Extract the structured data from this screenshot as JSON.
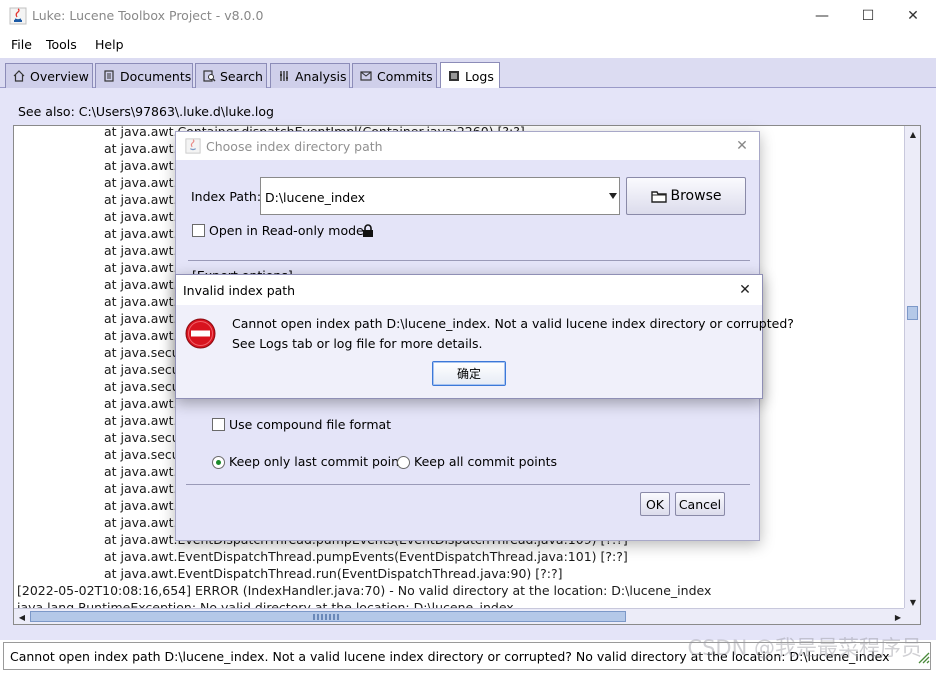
{
  "window": {
    "title": "Luke: Lucene Toolbox Project - v8.0.0",
    "minimize_glyph": "—",
    "maximize_glyph": "☐",
    "close_glyph": "✕"
  },
  "menu": {
    "file": "File",
    "tools": "Tools",
    "help": "Help"
  },
  "tabs": [
    {
      "label": "Overview",
      "icon": "home-icon"
    },
    {
      "label": "Documents",
      "icon": "documents-icon"
    },
    {
      "label": "Search",
      "icon": "search-icon"
    },
    {
      "label": "Analysis",
      "icon": "analysis-icon"
    },
    {
      "label": "Commits",
      "icon": "commits-icon"
    },
    {
      "label": "Logs",
      "icon": "logs-icon",
      "active": true
    }
  ],
  "logs": {
    "see_also": "See also: C:\\Users\\97863\\.luke.d\\luke.log",
    "lines": [
      "at java.awt.Container.dispatchEventImpl(Container.java:2260) [?:?]",
      "at java.awt.C",
      "at java.awt.C",
      "at java.awt.C",
      "at java.awt.Li",
      "at java.awt.Li",
      "at java.awt.Li",
      "at java.awt.C",
      "at java.awt.W",
      "at java.awt.C",
      "at java.awt.E",
      "at java.awt.E",
      "at java.awt.E",
      "at java.secu",
      "at java.secu",
      "at java.secu",
      "at java.awt.E",
      "at java.awt.E",
      "at java.secu",
      "at java.secu",
      "at java.awt.E",
      "at java.awt.E",
      "at java.awt.E",
      "at java.awt.E",
      "at java.awt.EventDispatchThread.pumpEvents(EventDispatchThread.java:109) [?:?]",
      "at java.awt.EventDispatchThread.pumpEvents(EventDispatchThread.java:101) [?:?]",
      "at java.awt.EventDispatchThread.run(EventDispatchThread.java:90) [?:?]",
      "[2022-05-02T10:08:16,654] ERROR (IndexHandler.java:70) - No valid directory at the location: D:\\lucene_index",
      "java.lang.RuntimeException: No valid directory at the location: D:\\lucene_index"
    ]
  },
  "status_bar": {
    "message": "Cannot open index path D:\\lucene_index. Not a valid lucene index directory or corrupted? No valid directory at the location: D:\\lucene_index",
    "watermark": "CSDN @我是最菜程序员"
  },
  "choose_dialog": {
    "title": "Choose index directory path",
    "index_path_label": "Index Path:",
    "index_path_value": "D:\\lucene_index",
    "browse_label": "Browse",
    "readonly_label": "Open in Read-only mode",
    "expert_options": "[Expert options]",
    "compound_label": "Use compound file format",
    "keep_last_label": "Keep only last commit point",
    "keep_all_label": "Keep all commit points",
    "ok_label": "OK",
    "cancel_label": "Cancel"
  },
  "error_dialog": {
    "title": "Invalid index path",
    "message_line1": "Cannot open index path D:\\lucene_index. Not a valid lucene index directory or corrupted?",
    "message_line2": "See Logs tab or log file for more details.",
    "ok_label": "确定"
  },
  "colors": {
    "accent": "#3c78d8",
    "error_red": "#d8131e",
    "panel_bg": "#e4e4f8",
    "tab_bg": "#cfcfea"
  }
}
